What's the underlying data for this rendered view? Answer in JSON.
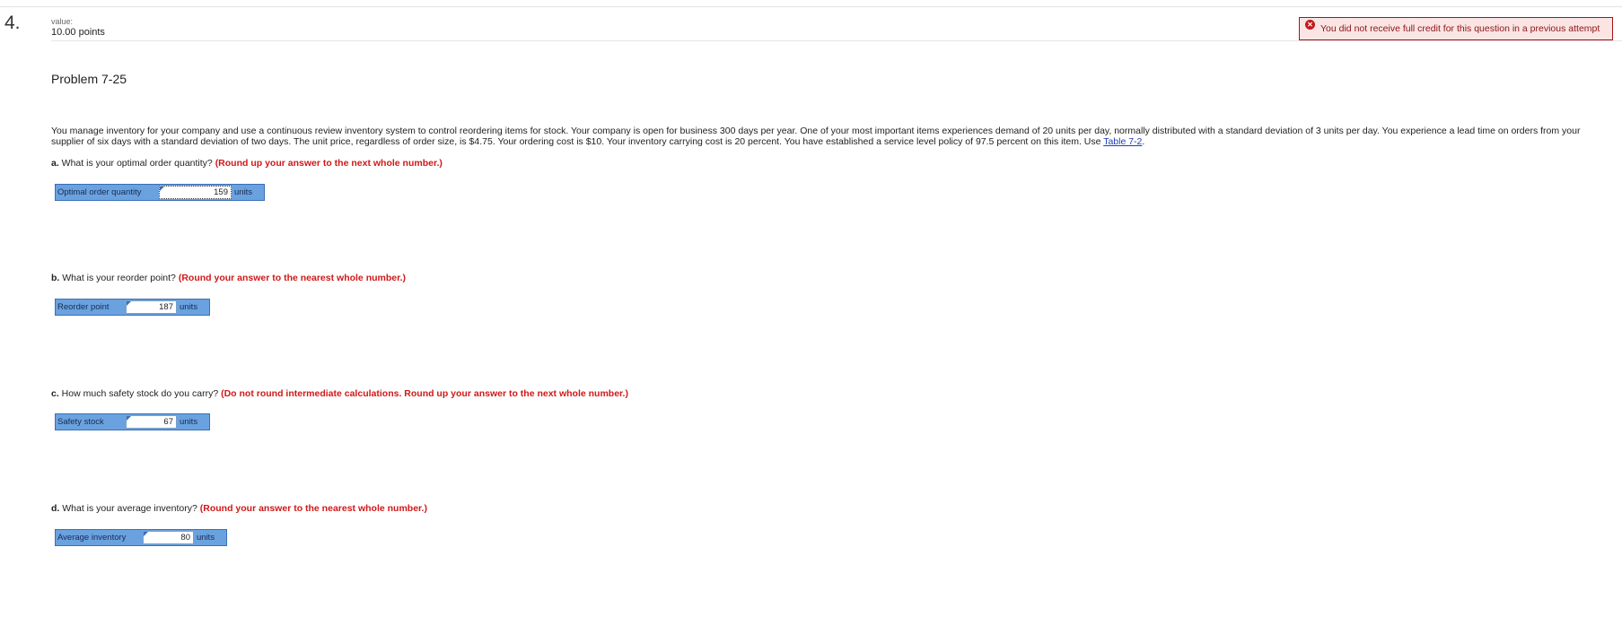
{
  "header": {
    "question_number": "4.",
    "value_label": "value:",
    "value_points": "10.00 points",
    "alert_text": "You did not receive full credit for this question in a previous attempt"
  },
  "problem": {
    "title": "Problem 7-25",
    "stem": "You manage inventory for your company and use a continuous review inventory system to control reordering items for stock. Your company is open for business 300 days per year. One of your most important items experiences demand of 20 units per day, normally distributed with a standard deviation of 3 units per day. You experience a lead time on orders from your supplier of six days with a standard deviation of two days. The unit price, regardless of order size, is $4.75. Your ordering cost is $10. Your inventory carrying cost is 20 percent. You have established a service level policy of 97.5 percent on this item. Use ",
    "table_link": "Table 7-2",
    "stem_end": "."
  },
  "questions": [
    {
      "letter": "a.",
      "text": " What is your optimal order quantity? ",
      "hint": "(Round up your answer to the next whole number.)",
      "field_label": "Optimal order quantity",
      "value": "159",
      "unit": "units"
    },
    {
      "letter": "b.",
      "text": " What is your reorder point? ",
      "hint": "(Round your answer to the nearest whole number.)",
      "field_label": "Reorder point",
      "value": "187",
      "unit": "units"
    },
    {
      "letter": "c.",
      "text": " How much safety stock do you carry? ",
      "hint": "(Do not round intermediate calculations. Round up your answer to the next whole number.)",
      "field_label": "Safety stock",
      "value": "67",
      "unit": "units"
    },
    {
      "letter": "d.",
      "text": " What is your average inventory? ",
      "hint": "(Round your answer to the nearest whole number.)",
      "field_label": "Average inventory",
      "value": "80",
      "unit": "units"
    }
  ]
}
